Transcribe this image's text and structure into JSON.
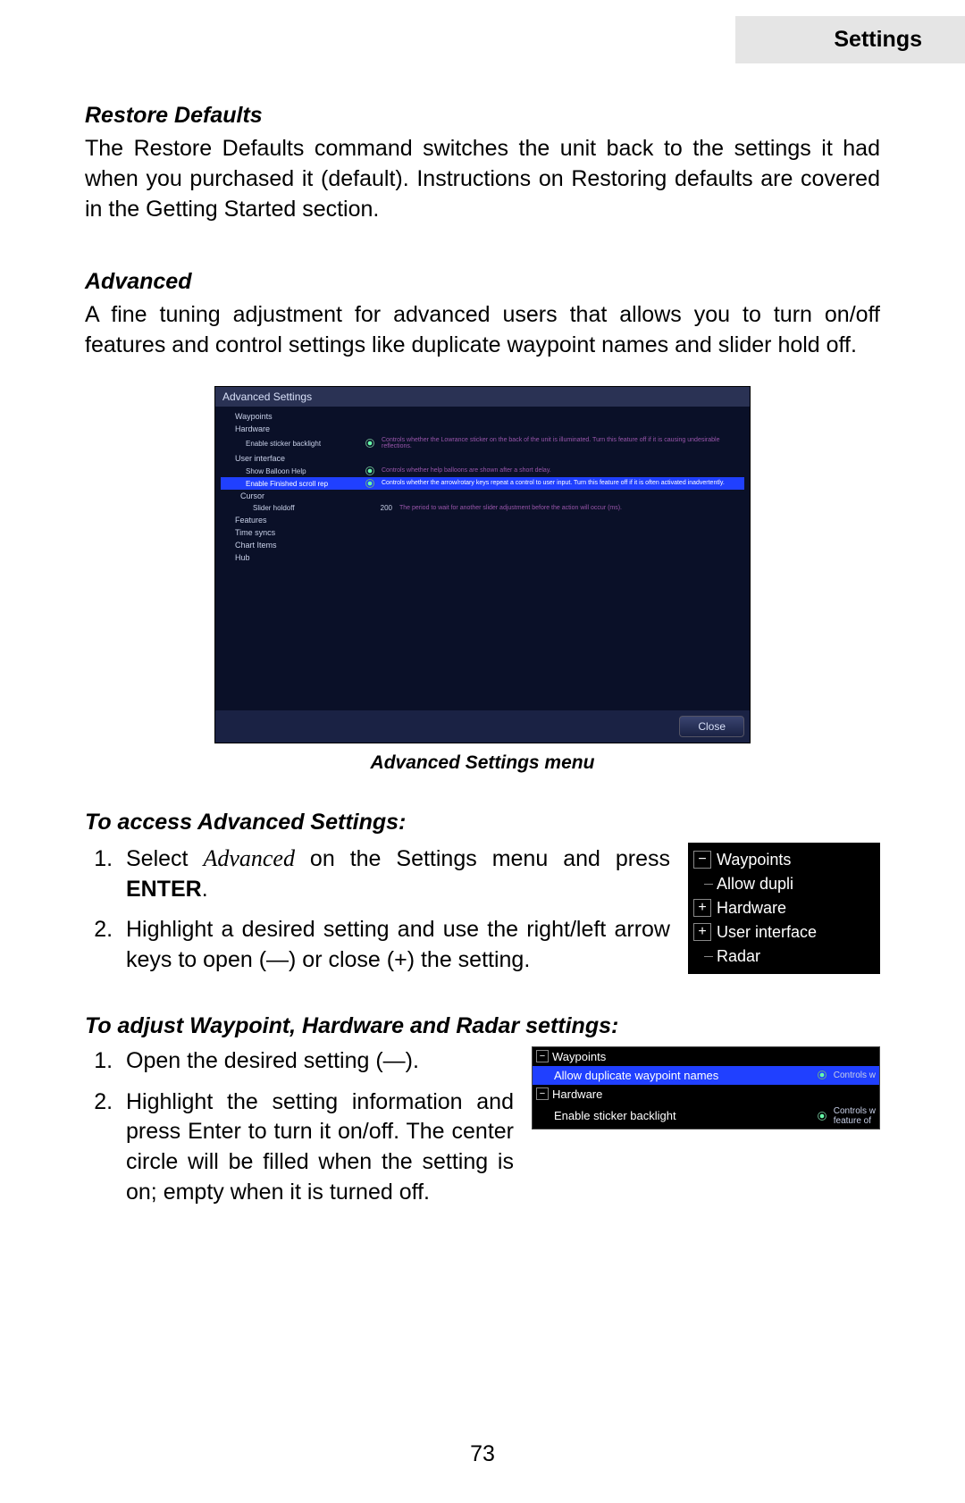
{
  "header_tab": "Settings",
  "s1": {
    "h": "Restore Defaults",
    "p": "The Restore Defaults command switches the unit back to the settings it had when you purchased it (default). Instructions on Restoring defaults are covered in the Getting Started section."
  },
  "s2": {
    "h": "Advanced",
    "p": "A fine tuning adjustment for advanced users that allows you to turn on/off features and control settings like duplicate waypoint names and slider hold off."
  },
  "fig1": {
    "title": "Advanced Settings",
    "tree": {
      "waypoints": "Waypoints",
      "hardware": "Hardware",
      "enable_backlight": "Enable sticker backlight",
      "enable_backlight_desc": "Controls whether the Lowrance sticker on the back of the unit is illuminated. Turn this feature off if it is causing undesirable reflections.",
      "ui": "User interface",
      "show_balloon": "Show Balloon Help",
      "show_balloon_desc": "Controls whether help balloons are shown after a short delay.",
      "enable_finished": "Enable Finished scroll rep",
      "enable_finished_desc": "Controls whether the arrow/rotary keys repeat a control to user input. Turn this feature off if it is often activated inadvertently.",
      "cursor": "Cursor",
      "slider_holdoff": "Slider holdoff",
      "slider_val": "200",
      "slider_desc": "The period to wait for another slider adjustment before the action will occur (ms).",
      "features": "Features",
      "time_sync": "Time syncs",
      "chart_items": "Chart Items",
      "hub": "Hub"
    },
    "close": "Close",
    "caption": "Advanced Settings menu"
  },
  "s3": {
    "h": "To access Advanced Settings:",
    "step1a": "Select ",
    "step1b": "Advanced",
    "step1c": " on the Settings menu and press ",
    "step1d": "ENTER",
    "step1e": ".",
    "step2": "Highlight a desired setting and use the right/left arrow keys to open (—) or close (+) the setting."
  },
  "fig2": {
    "waypoints": "Waypoints",
    "allow": "Allow dupli",
    "hardware": "Hardware",
    "ui": "User interface",
    "radar": "Radar"
  },
  "s4": {
    "h": "To adjust Waypoint, Hardware and Radar settings:",
    "step1": "Open the desired setting (—).",
    "step2": "Highlight the setting information and press Enter to turn it on/off. The center circle will be filled when the setting is on; empty when it is turned off."
  },
  "fig3": {
    "waypoints": "Waypoints",
    "allow": "Allow duplicate waypoint names",
    "allow_desc": "Controls w",
    "hardware": "Hardware",
    "enable": "Enable sticker backlight",
    "enable_desc1": "Controls w",
    "enable_desc2": "feature of"
  },
  "page_num": "73"
}
